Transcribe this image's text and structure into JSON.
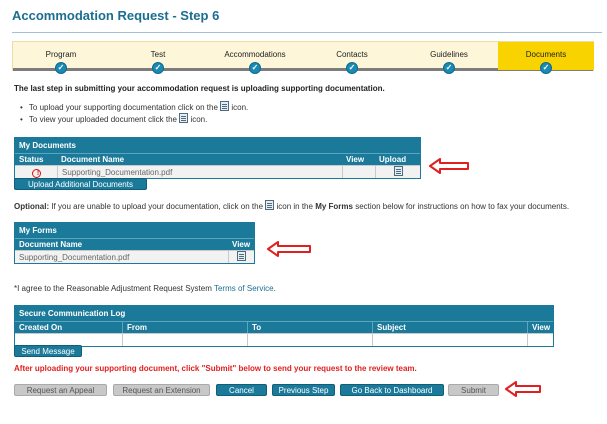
{
  "page": {
    "title": "Accommodation Request - Step 6"
  },
  "steps": [
    {
      "label": "Program",
      "active": false
    },
    {
      "label": "Test",
      "active": false
    },
    {
      "label": "Accommodations",
      "active": false
    },
    {
      "label": "Contacts",
      "active": false
    },
    {
      "label": "Guidelines",
      "active": false
    },
    {
      "label": "Documents",
      "active": true
    }
  ],
  "step_check": "✓",
  "intro": "The last step in submitting your accommodation request is uploading supporting documentation.",
  "bullets": {
    "upload_before": "To upload your supporting documentation click on the",
    "upload_after": "icon.",
    "view_before": "To view your uploaded document click the",
    "view_after": "icon."
  },
  "my_documents": {
    "caption": "My Documents",
    "headers": {
      "status": "Status",
      "name": "Document Name",
      "view": "View",
      "upload": "Upload"
    },
    "rows": [
      {
        "status_icon": "alert-icon",
        "name": "Supporting_Documentation.pdf"
      }
    ],
    "upload_additional": "Upload Additional Documents"
  },
  "optional": {
    "label": "Optional:",
    "text_before": " If you are unable to upload your documentation, click on the",
    "text_mid": " icon in the ",
    "my_forms_bold": "My Forms",
    "text_after": " section below for instructions on how to fax your documents."
  },
  "my_forms": {
    "caption": "My Forms",
    "headers": {
      "name": "Document Name",
      "view": "View"
    },
    "rows": [
      {
        "name": "Supporting_Documentation.pdf"
      }
    ]
  },
  "agree": {
    "text": "*I agree to the Reasonable Adjustment Request System ",
    "link": "Terms of Service",
    "end": "."
  },
  "comm_log": {
    "caption": "Secure Communication Log",
    "headers": {
      "created": "Created On",
      "from": "From",
      "to": "To",
      "subject": "Subject",
      "view": "View"
    },
    "send_message": "Send Message"
  },
  "red_note": "After uploading your supporting document, click \"Submit\" below to send your request to the review team.",
  "actions": {
    "request_appeal": "Request an Appeal",
    "request_extension": "Request an Extension",
    "cancel": "Cancel",
    "previous_step": "Previous Step",
    "dashboard": "Go Back to Dashboard",
    "submit": "Submit"
  },
  "colors": {
    "accent": "#1b7a9a",
    "active_step": "#f9d300",
    "warning": "#e02020"
  }
}
